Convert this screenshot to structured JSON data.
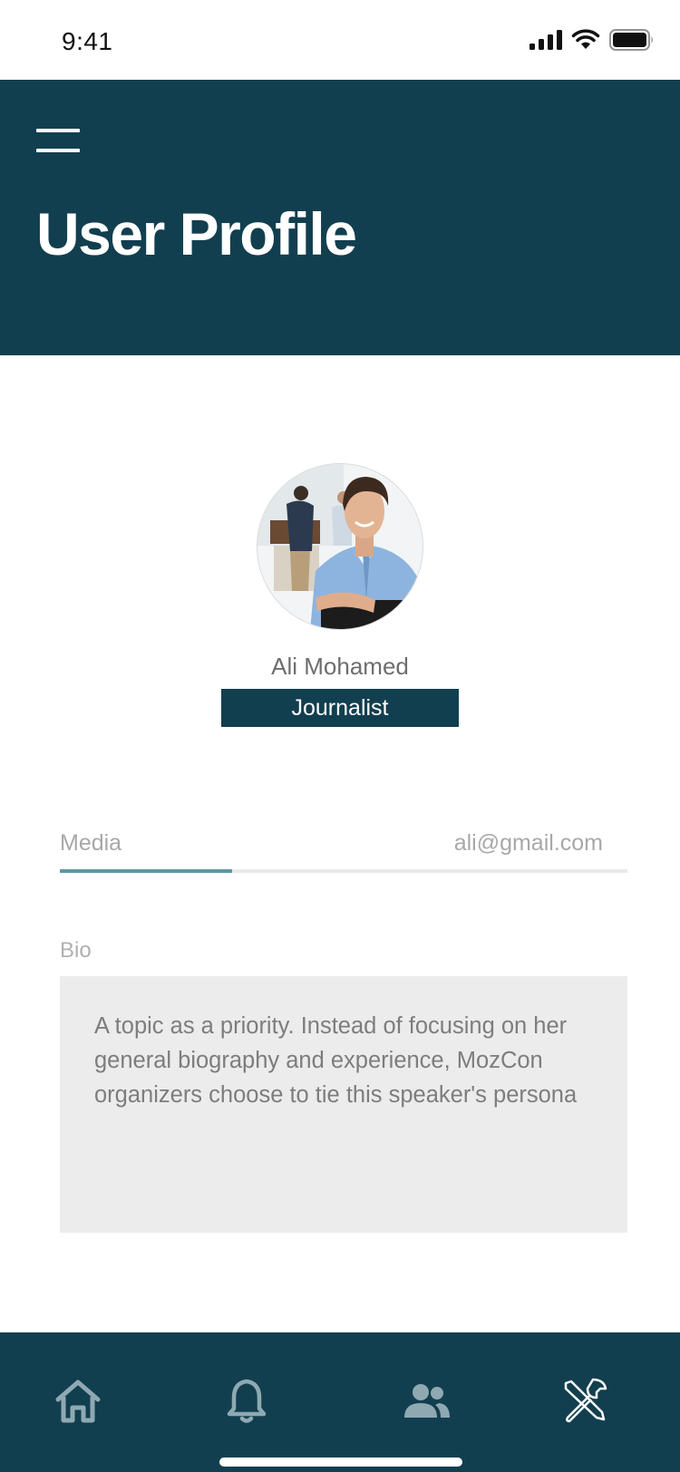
{
  "status_bar": {
    "time": "9:41",
    "icons": [
      "cellular-signal-icon",
      "wifi-icon",
      "battery-icon"
    ]
  },
  "header": {
    "menu_icon": "hamburger-menu-icon",
    "title": "User Profile"
  },
  "profile": {
    "name": "Ali Mohamed",
    "role": "Journalist"
  },
  "tabs": {
    "items": [
      {
        "label": "Media",
        "active": true
      },
      {
        "label": "ali@gmail.com",
        "active": false
      }
    ]
  },
  "bio": {
    "label": "Bio",
    "text": "A topic as a priority. Instead of focusing on her general biography and experience, MozCon organizers choose to tie this speaker's persona"
  },
  "bottom_nav": {
    "items": [
      "home-icon",
      "notification-bell-icon",
      "people-icon",
      "tools-icon"
    ]
  },
  "colors": {
    "primary": "#123f4f",
    "accent": "#5e97a5",
    "bio_background": "#ececec",
    "text_muted": "#a8a8a8"
  }
}
